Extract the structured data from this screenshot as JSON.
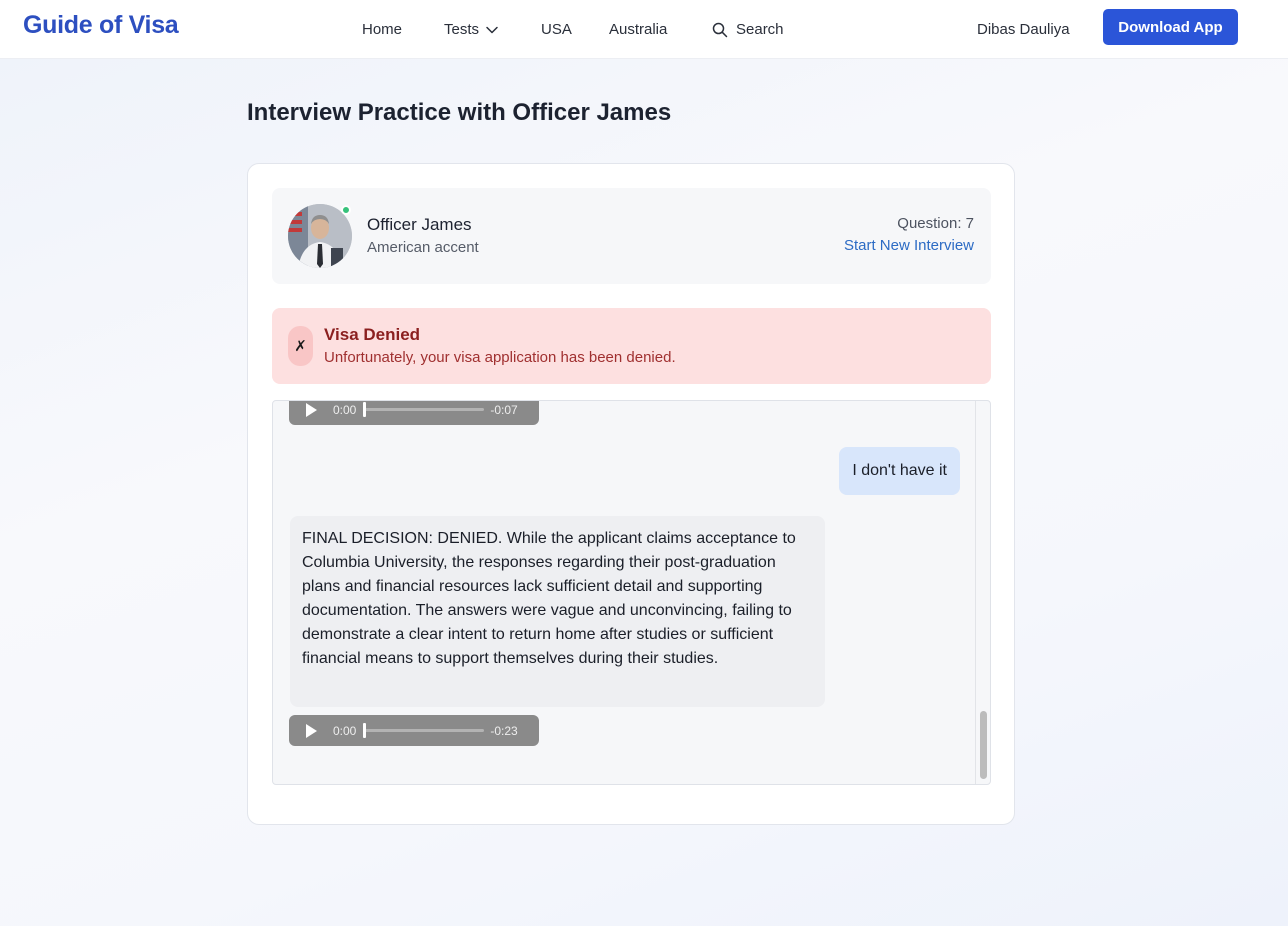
{
  "header": {
    "logo": "Guide of Visa",
    "nav": [
      {
        "label": "Home",
        "icon": null
      },
      {
        "label": "Tests",
        "icon": "chevron-down-icon"
      },
      {
        "label": "USA",
        "icon": null
      },
      {
        "label": "Australia",
        "icon": null
      },
      {
        "label": "Search",
        "icon": "search-icon"
      }
    ],
    "user_name": "Dibas Dauliya",
    "download_label": "Download App"
  },
  "page": {
    "title": "Interview Practice with Officer James"
  },
  "officer": {
    "name": "Officer James",
    "accent": "American accent",
    "question_label": "Question: 7",
    "new_interview_label": "Start New Interview",
    "status_color": "#36c27b"
  },
  "decision": {
    "icon": "✗",
    "title": "Visa Denied",
    "message": "Unfortunately, your visa application has been denied."
  },
  "chat": {
    "messages": [
      {
        "type": "audio",
        "current": "0:00",
        "remaining": "-0:07",
        "progress": 0
      },
      {
        "type": "user",
        "text": "I don't have it"
      },
      {
        "type": "officer",
        "text": "FINAL DECISION: DENIED. While the applicant claims acceptance to Columbia University, the responses regarding their post-graduation plans and financial resources lack sufficient detail and supporting documentation. The answers were vague and unconvincing, failing to demonstrate a clear intent to return home after studies or sufficient financial means to support themselves during their studies."
      },
      {
        "type": "audio",
        "current": "0:00",
        "remaining": "-0:23",
        "progress": 0
      }
    ]
  },
  "colors": {
    "brand": "#2d4fc0",
    "button": "#2b55d8",
    "denied_bg": "#fde0e0",
    "denied_text": "#8b1f1f",
    "user_bubble": "#d8e6fb",
    "link": "#2c6bc4"
  }
}
